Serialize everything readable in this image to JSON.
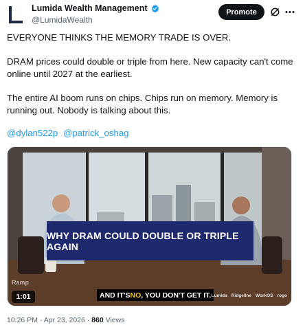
{
  "author": {
    "display_name": "Lumida Wealth Management",
    "handle": "@LumidaWealth",
    "verified_icon": "verified-badge-icon",
    "avatar_icon": "lumida-logo-icon"
  },
  "header": {
    "promote_label": "Promote",
    "grok_icon": "grok-icon",
    "more_icon": "more-icon"
  },
  "post": {
    "line1": "EVERYONE THINKS THE MEMORY TRADE IS OVER.",
    "line2": "DRAM prices could double or triple from here. New capacity can't come online until 2027 at the earliest.",
    "line3": "The entire AI boom runs on chips. Chips run on memory. Memory is running out. Nobody is talking about this.",
    "mentions": [
      "@dylan522p",
      "@patrick_oshag"
    ]
  },
  "video": {
    "title_card": "WHY DRAM COULD DOUBLE OR TRIPLE AGAIN",
    "caption_prefix": "AND IT'S ",
    "caption_highlight": "NO",
    "caption_suffix": ", YOU DON'T GET IT.",
    "duration": "1:01",
    "brand_left": "Ramp",
    "sponsors": [
      "Lumida",
      "Ridgeline",
      "WorkOS",
      "rogo"
    ]
  },
  "meta": {
    "time": "10:26 PM",
    "separator": " · ",
    "date": "Apr 23, 2026",
    "views_count": "860",
    "views_label": " Views"
  },
  "colors": {
    "link": "#1d9bf0",
    "verified": "#1d9bf0",
    "title_card_bg": "#1f2a6e",
    "caption_highlight": "#f5c518"
  }
}
